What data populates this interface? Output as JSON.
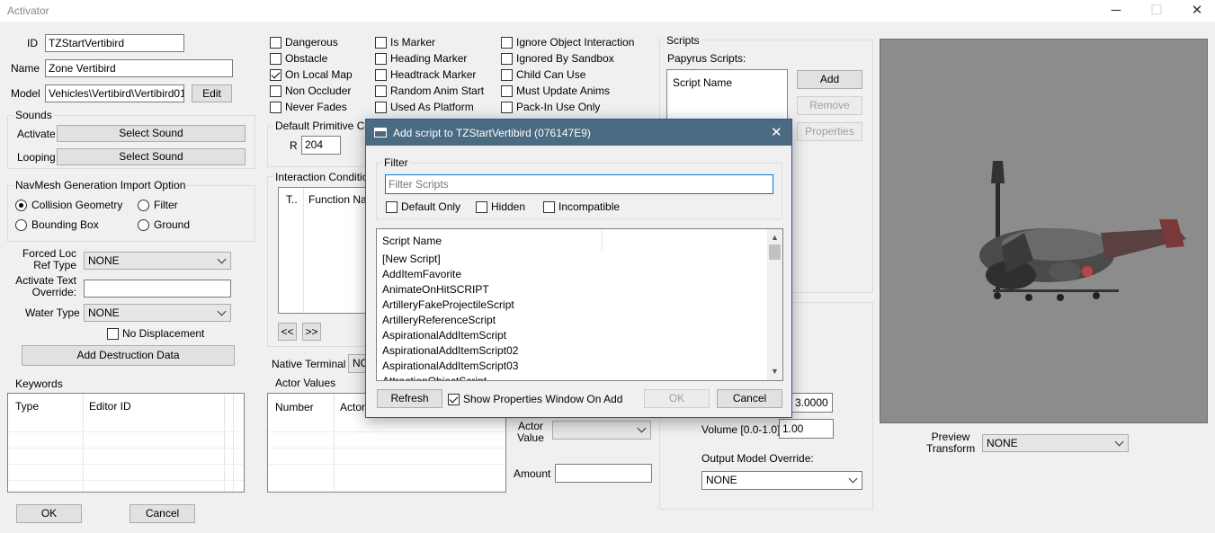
{
  "window": {
    "title": "Activator",
    "minimize": "─",
    "maximize": "☐",
    "close": "✕"
  },
  "basic": {
    "id_label": "ID",
    "id_value": "TZStartVertibird",
    "name_label": "Name",
    "name_value": "Zone Vertibird",
    "model_label": "Model",
    "model_value": "Vehicles\\Vertibird\\Vertibird01.ni",
    "edit_button": "Edit"
  },
  "sounds": {
    "group_label": "Sounds",
    "activate_label": "Activate",
    "activate_button": "Select Sound",
    "looping_label": "Looping",
    "looping_button": "Select Sound"
  },
  "navmesh": {
    "group_label": "NavMesh Generation Import Option",
    "options": [
      {
        "label": "Collision Geometry",
        "checked": true
      },
      {
        "label": "Filter",
        "checked": false
      },
      {
        "label": "Bounding Box",
        "checked": false
      },
      {
        "label": "Ground",
        "checked": false
      }
    ]
  },
  "forced_loc": {
    "label_line1": "Forced Loc",
    "label_line2": "Ref Type",
    "value": "NONE"
  },
  "activate_text": {
    "label_line1": "Activate Text",
    "label_line2": "Override:",
    "value": ""
  },
  "water": {
    "label": "Water Type",
    "value": "NONE",
    "no_displacement": "No Displacement"
  },
  "destruction_button": "Add Destruction Data",
  "keywords": {
    "label": "Keywords",
    "col_type": "Type",
    "col_editor_id": "Editor ID"
  },
  "bottom_buttons": {
    "ok": "OK",
    "cancel": "Cancel"
  },
  "flags": {
    "col1": [
      {
        "label": "Dangerous",
        "checked": false
      },
      {
        "label": "Obstacle",
        "checked": false
      },
      {
        "label": "On Local Map",
        "checked": true
      },
      {
        "label": "Non Occluder",
        "checked": false
      },
      {
        "label": "Never Fades",
        "checked": false
      }
    ],
    "col2": [
      {
        "label": "Is Marker",
        "checked": false
      },
      {
        "label": "Heading Marker",
        "checked": false
      },
      {
        "label": "Headtrack Marker",
        "checked": false
      },
      {
        "label": "Random Anim Start",
        "checked": false
      },
      {
        "label": "Used As Platform",
        "checked": false
      }
    ],
    "col3": [
      {
        "label": "Ignore Object Interaction",
        "checked": false
      },
      {
        "label": "Ignored By Sandbox",
        "checked": false
      },
      {
        "label": "Child Can Use",
        "checked": false
      },
      {
        "label": "Must Update Anims",
        "checked": false
      },
      {
        "label": "Pack-In Use Only",
        "checked": false
      }
    ]
  },
  "primitive": {
    "group_label": "Default Primitive Colo",
    "r_label": "R",
    "r_value": "204"
  },
  "interaction": {
    "group_label": "Interaction Conditions",
    "col_t": "T..",
    "col_function": "Function Nam",
    "prev": "<<",
    "next": ">>"
  },
  "native_terminal": {
    "label": "Native Terminal",
    "value": "NO"
  },
  "actor_values": {
    "label": "Actor Values",
    "col_number": "Number",
    "col_actor": "Actor",
    "actor_value_label_line1": "Actor",
    "actor_value_label_line2": "Value",
    "amount_label": "Amount",
    "amount_value": ""
  },
  "scripts": {
    "group_label": "Scripts",
    "papyrus_label": "Papyrus Scripts:",
    "col_script_name": "Script Name",
    "add": "Add",
    "remove": "Remove",
    "properties": "Properties"
  },
  "sound_opts": {
    "value1": "3.0000",
    "volume_label": "Volume [0.0-1.0]:",
    "volume_value": "1.00",
    "output_label": "Output Model Override:",
    "output_value": "NONE"
  },
  "preview": {
    "label_line1": "Preview",
    "label_line2": "Transform",
    "value": "NONE"
  },
  "dialog": {
    "title": "Add script to TZStartVertibird (076147E9)",
    "filter_group": "Filter",
    "filter_placeholder": "Filter Scripts",
    "default_only": "Default Only",
    "hidden": "Hidden",
    "incompatible": "Incompatible",
    "list_header": "Script Name",
    "items": [
      "[New Script]",
      "AddItemFavorite",
      "AnimateOnHitSCRIPT",
      "ArtilleryFakeProjectileScript",
      "ArtilleryReferenceScript",
      "AspirationalAddItemScript",
      "AspirationalAddItemScript02",
      "AspirationalAddItemScript03",
      "AttractionObjectScript"
    ],
    "refresh": "Refresh",
    "show_props": "Show Properties Window On Add",
    "ok": "OK",
    "cancel": "Cancel"
  }
}
